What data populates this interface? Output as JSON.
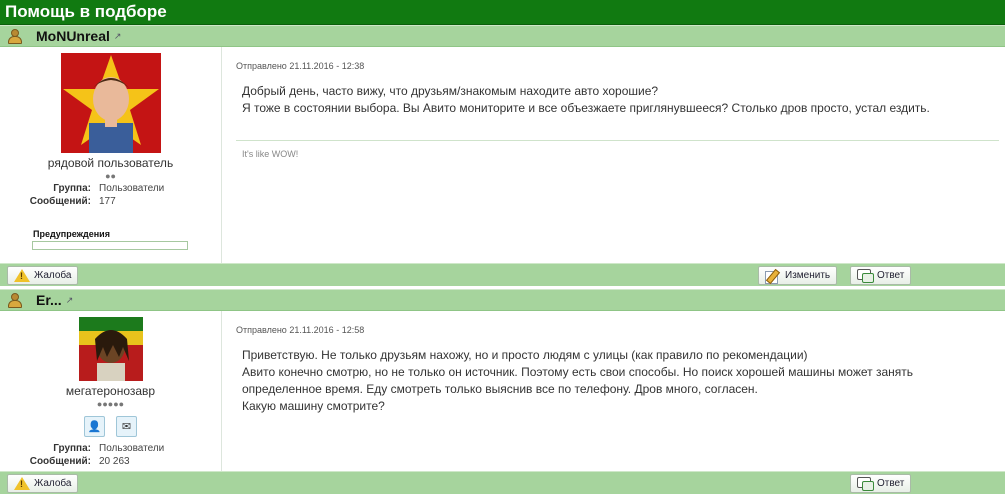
{
  "topic": {
    "title": "Помощь в подборе"
  },
  "posts": [
    {
      "author": "MoNUnreal",
      "rank": "рядовой пользователь",
      "pips": "●●",
      "group_label": "Группа:",
      "group_value": "Пользователи",
      "posts_label": "Сообщений:",
      "posts_value": "177",
      "warnings_label": "Предупреждения",
      "date": "Отправлено 21.11.2016 - 12:38",
      "lines": [
        "Добрый день, часто вижу, что друзьям/знакомым находите авто хорошие?",
        "Я тоже в состоянии выбора. Вы Авито мониторите и все объезжаете приглянувшееся? Столько дров просто, устал ездить."
      ],
      "signature": "It's like WOW!",
      "buttons": {
        "report": "Жалоба",
        "edit": "Изменить",
        "reply": "Ответ"
      }
    },
    {
      "author": "Er...",
      "rank": "мегатеронозавр",
      "pips": "●●●●●",
      "group_label": "Группа:",
      "group_value": "Пользователи",
      "posts_label": "Сообщений:",
      "posts_value": "20 263",
      "date": "Отправлено 21.11.2016 - 12:58",
      "lines": [
        "Приветствую. Не только друзьям нахожу, но и просто людям с улицы (как правило по рекомендации)",
        "Авито конечно смотрю, но не только он источник. Поэтому есть свои способы. Но поиск хорошей машины может занять",
        "определенное время. Еду смотреть только выяснив все по телефону. Дров много, согласен.",
        "Какую машину смотрите?"
      ],
      "buttons": {
        "report": "Жалоба",
        "reply": "Ответ"
      }
    }
  ],
  "colors": {
    "header": "#117a11",
    "bar": "#a6d49d",
    "warning": "#f0c22a"
  }
}
